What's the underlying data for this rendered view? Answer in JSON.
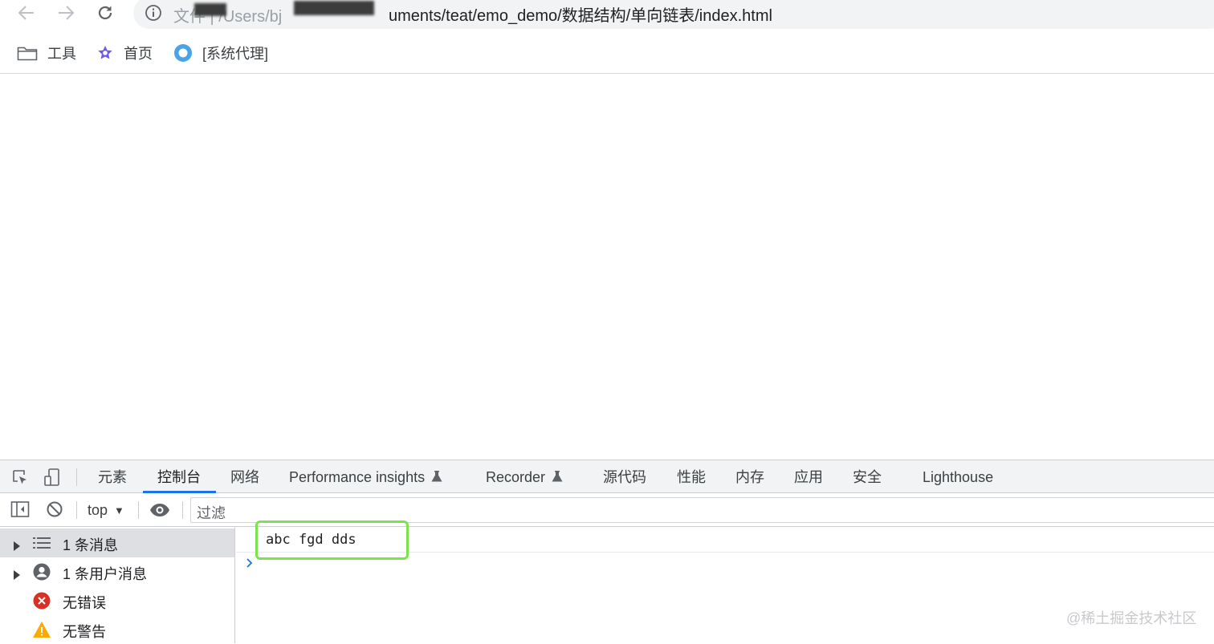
{
  "browser": {
    "url_prefix": "文件 | /Users/bj",
    "url_visible": "uments/teat/emo_demo/数据结构/单向链表/index.html",
    "bookmarks": [
      {
        "label": "工具",
        "icon": "folder-icon"
      },
      {
        "label": "首页",
        "icon": "star-logo-icon"
      },
      {
        "label": "[系统代理]",
        "icon": "circle-icon"
      }
    ]
  },
  "devtools": {
    "tabs": [
      {
        "label": "元素"
      },
      {
        "label": "控制台",
        "active": true
      },
      {
        "label": "网络"
      },
      {
        "label": "Performance insights"
      },
      {
        "label": "Recorder"
      },
      {
        "label": "源代码"
      },
      {
        "label": "性能"
      },
      {
        "label": "内存"
      },
      {
        "label": "应用"
      },
      {
        "label": "安全"
      },
      {
        "label": "Lighthouse"
      }
    ],
    "context": "top",
    "filter_placeholder": "过滤",
    "sidebar": [
      {
        "label": "1 条消息",
        "icon": "list-icon"
      },
      {
        "label": "1 条用户消息",
        "icon": "user-circle-icon"
      },
      {
        "label": "无错误",
        "icon": "error-icon"
      },
      {
        "label": "无警告",
        "icon": "warning-icon"
      }
    ],
    "console_output": "abc fgd dds"
  },
  "watermark": "@稀土掘金技术社区",
  "colors": {
    "accent": "#1a73e8",
    "highlight": "#7ce24e",
    "error": "#d93025",
    "warning": "#f9ab00"
  }
}
